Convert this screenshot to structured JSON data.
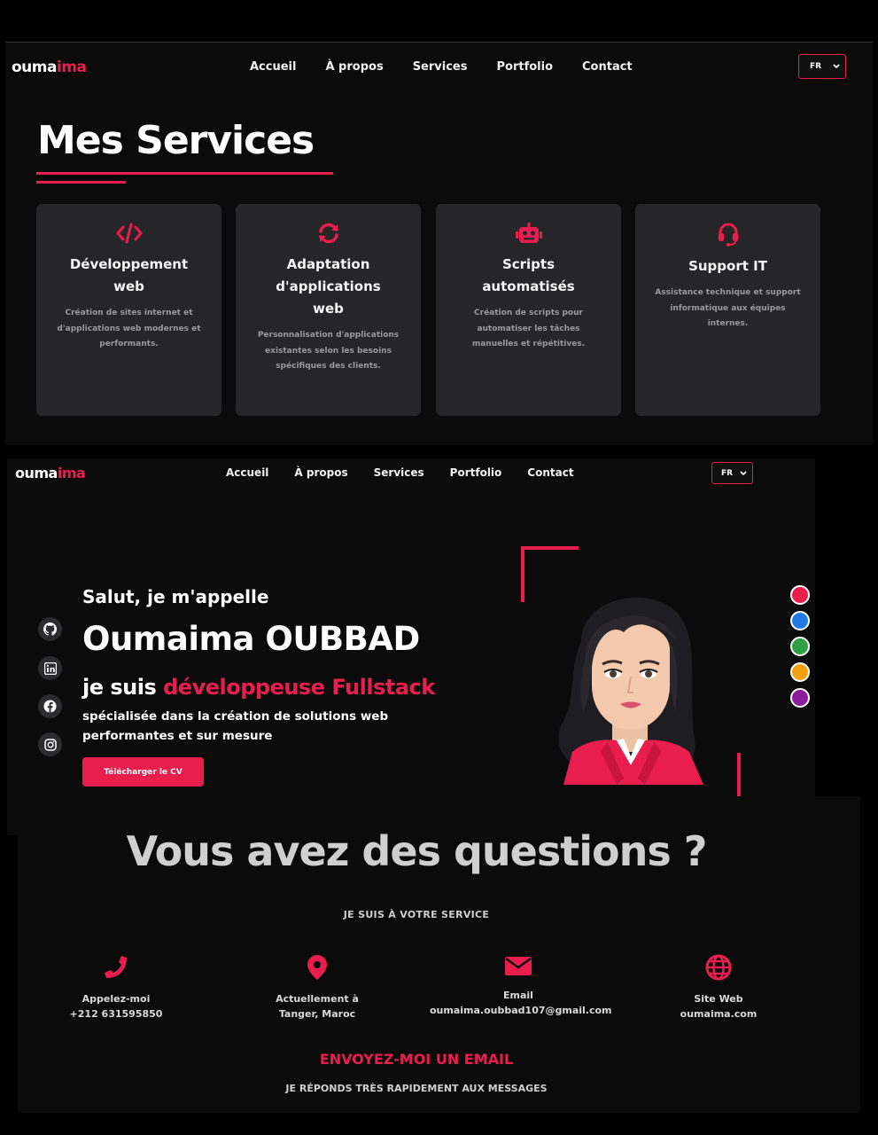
{
  "colors": {
    "accent": "#e91e4f",
    "background": "#0b0b0c",
    "card": "#262628"
  },
  "logo": {
    "part1": "ouma",
    "part2": "ima"
  },
  "nav": [
    "Accueil",
    "À propos",
    "Services",
    "Portfolio",
    "Contact"
  ],
  "lang": "FR",
  "services": {
    "title": "Mes Services",
    "cards": [
      {
        "icon": "code-icon",
        "title1": "Développement",
        "title2": "web",
        "title3": "",
        "desc": "Création de sites internet et d'applications web modernes et performants."
      },
      {
        "icon": "sync-icon",
        "title1": "Adaptation",
        "title2": "d'applications",
        "title3": "web",
        "desc": "Personnalisation d'applications existantes selon les besoins spécifiques des clients."
      },
      {
        "icon": "robot-icon",
        "title1": "Scripts",
        "title2": "automatisés",
        "title3": "",
        "desc": "Création de scripts pour automatiser les tâches manuelles et répétitives."
      },
      {
        "icon": "headset-icon",
        "title1": "Support IT",
        "title2": "",
        "title3": "",
        "desc": "Assistance technique et support informatique aux équipes internes."
      }
    ]
  },
  "hero": {
    "greeting": "Salut, je m'appelle",
    "name": "Oumaima OUBBAD",
    "role_prefix": "je suis ",
    "role_highlight": "développeuse Fullstack",
    "desc_line1": "spécialisée dans la création de solutions web",
    "desc_line2": "performantes et sur mesure",
    "cv_button": "Télécharger le CV",
    "social": [
      "github-icon",
      "linkedin-icon",
      "facebook-icon",
      "instagram-icon"
    ],
    "theme_colors": [
      "#e91e4f",
      "#1e7be3",
      "#2ea043",
      "#f5a00f",
      "#8e1b9e"
    ]
  },
  "contact": {
    "title": "Vous avez des questions ?",
    "subtitle": "JE SUIS À VOTRE SERVICE",
    "items": [
      {
        "icon": "phone-icon",
        "label": "Appelez-moi",
        "value": "+212 631595850"
      },
      {
        "icon": "location-icon",
        "label": "Actuellement à",
        "value": "Tanger, Maroc"
      },
      {
        "icon": "email-icon",
        "label": "Email",
        "value": "oumaima.oubbad107@gmail.com"
      },
      {
        "icon": "globe-icon",
        "label": "Site Web",
        "value": "oumaima.com"
      }
    ],
    "mail_title": "ENVOYEZ-MOI UN EMAIL",
    "mail_sub": "JE RÉPONDS TRÈS RAPIDEMENT AUX MESSAGES"
  }
}
